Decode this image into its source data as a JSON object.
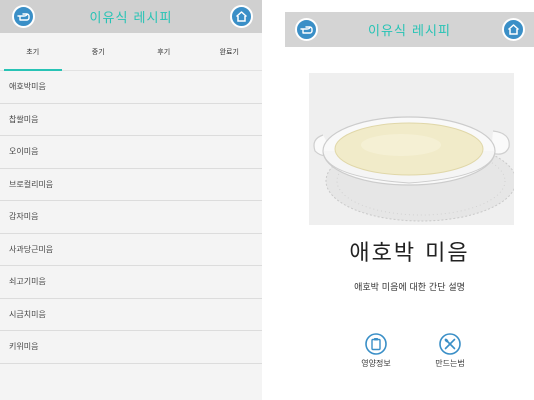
{
  "left": {
    "title": "이유식 레시피",
    "tabs": [
      "초기",
      "중기",
      "후기",
      "완료기"
    ],
    "active_tab": 0,
    "items": [
      "애호박미음",
      "찹쌀미음",
      "오이미음",
      "브로컬리미음",
      "감자미음",
      "사과당근미음",
      "쇠고기미음",
      "시금치미음",
      "키위미음"
    ]
  },
  "right": {
    "title": "이유식 레시피",
    "dish_name": "애호박 미음",
    "dish_desc": "애호박 미음에 대한 간단 설명",
    "actions": [
      "영양정보",
      "만드는법"
    ]
  },
  "colors": {
    "accent": "#27c3b5",
    "icon_blue": "#3a8fc7",
    "topbar": "#d0d0d0"
  },
  "icons": {
    "back": "pointing-hand-icon",
    "home": "home-icon",
    "nutrition": "clipboard-icon",
    "recipe": "utensils-icon"
  }
}
